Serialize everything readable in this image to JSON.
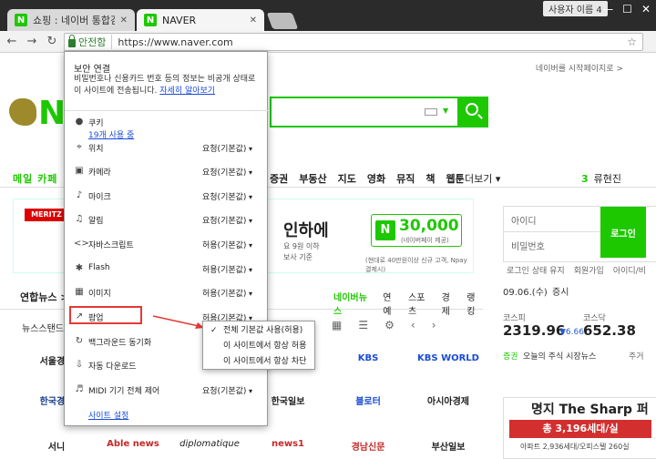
{
  "browser": {
    "tabs": [
      {
        "icon": "N",
        "label": "쇼핑 : 네이버 통합검색",
        "close": "✕"
      },
      {
        "icon": "N",
        "label": "NAVER",
        "close": "✕"
      }
    ],
    "window_user": "사용자 이름 4",
    "secure_label": "안전함",
    "url": "https://www.naver.com"
  },
  "page": {
    "top_right": "네이버를 시작페이지로 >",
    "logo_letter": "N",
    "menu_left": "메일 카페",
    "menu_items": [
      "증권",
      "부동산",
      "지도",
      "영화",
      "뮤직",
      "책",
      "웹툰"
    ],
    "menu_more": "더보기 ▾",
    "ranking_num": "3",
    "ranking_word": "류현진",
    "ad": {
      "brand": "MERITZ",
      "headline": "인하에",
      "line1": "요 9원 이하",
      "line2": "보사 기준",
      "price": "30,000",
      "price_sub": "(네이버페이 제공)",
      "foot": "(현대로 40만원이상 신규 고객, Npay 결제시)"
    },
    "login": {
      "id_placeholder": "아이디",
      "pw_placeholder": "비밀번호",
      "button": "로그인",
      "opt1": "로그인 상태 유지",
      "opt2": "회원가입",
      "opt3": "아이디/비"
    },
    "news": {
      "label": "연합뉴스 >",
      "tabs": [
        "네이버뉴스",
        "연예",
        "스포츠",
        "경제",
        "랭킹"
      ],
      "stand_label": "뉴스스탠드 >",
      "press": [
        "서울경제",
        "KBS",
        "KBS WORLD",
        "한국경제",
        "한국일보",
        "블로터",
        "아시아경제",
        "서니",
        "Able news",
        "diplomatique",
        "news1",
        "경남신문",
        "부산일보"
      ]
    },
    "stock": {
      "date": "09.06.(수)",
      "label": "증시",
      "kospi_label": "코스피",
      "kospi_value": "2319.96",
      "kospi_change": "▼6.66",
      "kosdaq_label": "코스닥",
      "kosdaq_value": "652.38",
      "news_tag": "증권",
      "news_text": "오늘의 주식 시장뉴스",
      "more": "주거"
    },
    "bottom_ad": {
      "title": "명지 The Sharp 퍼스트힐",
      "bar": "총 3,196세대/실",
      "sub": "아파트 2,936세대/오피스텔 260실"
    }
  },
  "popup": {
    "title": "보안 연결",
    "desc_text": "비밀번호나 신용카드 번호 등의 정보는 비공개 상태로 이 사이트에 전송됩니다.",
    "desc_link": "자세히 알아보기",
    "cookie_label": "쿠키",
    "cookie_sub": "19개 사용 중",
    "permissions": [
      {
        "icon": "⌖",
        "name": "위치",
        "value": "요청(기본값)"
      },
      {
        "icon": "▣",
        "name": "카메라",
        "value": "요청(기본값)"
      },
      {
        "icon": "♪",
        "name": "마이크",
        "value": "요청(기본값)"
      },
      {
        "icon": "♫",
        "name": "알림",
        "value": "요청(기본값)"
      },
      {
        "icon": "<>",
        "name": "자바스크립트",
        "value": "허용(기본값)"
      },
      {
        "icon": "✱",
        "name": "Flash",
        "value": "허용(기본값)"
      },
      {
        "icon": "▦",
        "name": "이미지",
        "value": "허용(기본값)"
      },
      {
        "icon": "↗",
        "name": "팝업",
        "value": "허용(기본값)"
      },
      {
        "icon": "↻",
        "name": "백그라운드 동기화",
        "value": ""
      },
      {
        "icon": "⇩",
        "name": "자동 다운로드",
        "value": ""
      },
      {
        "icon": "♬",
        "name": "MIDI 기기 전체 제어",
        "value": "요청(기본값)"
      }
    ],
    "site_settings": "사이트 설정"
  },
  "dropdown": {
    "options": [
      "전체 기본값 사용(허용)",
      "이 사이트에서 항상 허용",
      "이 사이트에서 항상 차단"
    ],
    "check": "✓"
  }
}
